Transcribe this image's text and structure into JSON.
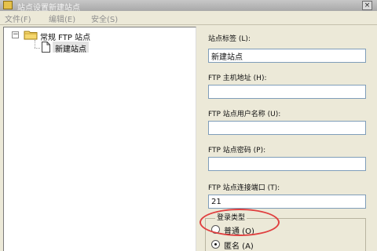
{
  "window": {
    "title": "站点设置新建站点",
    "close_glyph": "×"
  },
  "menu": {
    "items": [
      "文件(F)",
      "编辑(E)",
      "安全(S)"
    ]
  },
  "tree": {
    "expander_glyph": "−",
    "root_label": "常规 FTP 站点",
    "child_label": "新建站点"
  },
  "form": {
    "site_label": {
      "label": "站点标签 (L):",
      "value": "新建站点"
    },
    "host": {
      "label": "FTP 主机地址 (H):",
      "value": ""
    },
    "user": {
      "label": "FTP 站点用户名称 (U):",
      "value": ""
    },
    "password": {
      "label": "FTP 站点密码 (P):",
      "value": ""
    },
    "port": {
      "label": "FTP 站点连接端口 (T):",
      "value": "21"
    },
    "login_type": {
      "title": "登录类型",
      "options": [
        "普通 (O)",
        "匿名 (A)"
      ],
      "selected": "匿名 (A)"
    }
  },
  "colors": {
    "annotation": "#e04040",
    "selection": "#e2e2e2"
  }
}
